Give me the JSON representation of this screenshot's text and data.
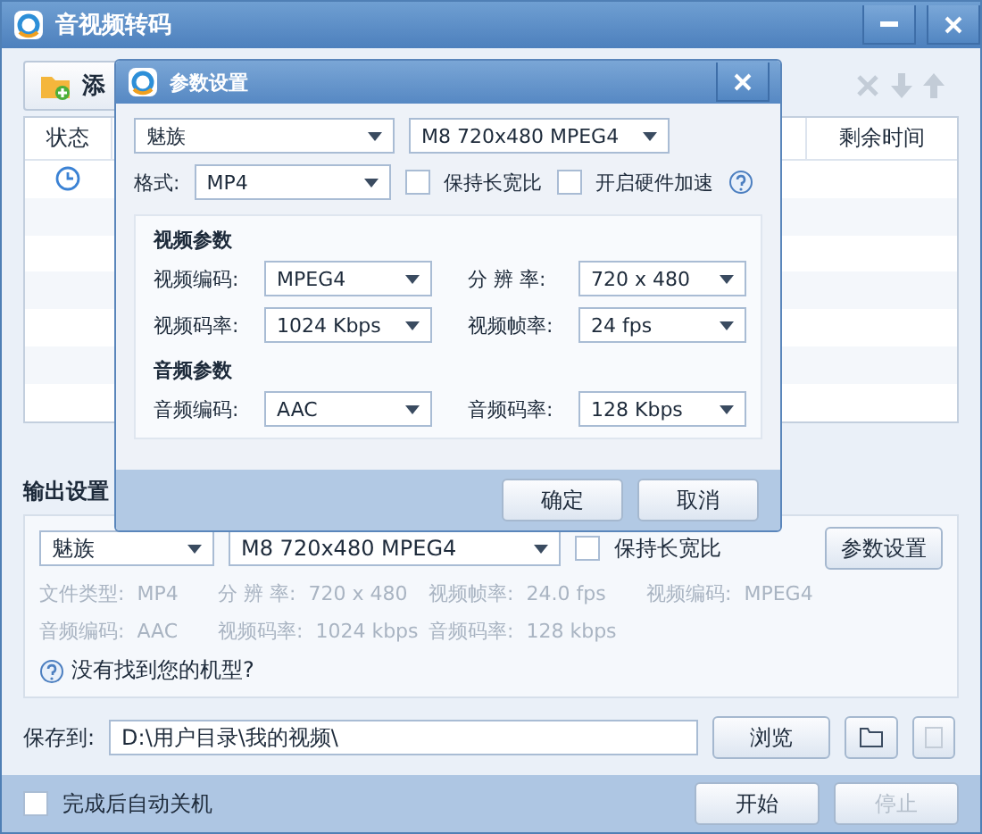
{
  "window": {
    "title": "音视频转码"
  },
  "toolbar": {
    "add_label": "添"
  },
  "table": {
    "columns": [
      "状态",
      "剩余时间"
    ],
    "rows": [
      {
        "kind": "waiting"
      }
    ]
  },
  "output": {
    "title": "输出设置",
    "brand": "魅族",
    "preset": "M8 720x480 MPEG4",
    "keep_ratio": {
      "label": "保持长宽比",
      "checked": false
    },
    "settings_button": "参数设置",
    "info": [
      [
        {
          "label": "文件类型:",
          "value": "MP4"
        },
        {
          "label": "分 辨 率:",
          "value": "720 x 480"
        },
        {
          "label": "视频帧率:",
          "value": "24.0 fps"
        },
        {
          "label": "视频编码:",
          "value": "MPEG4"
        }
      ],
      [
        {
          "label": "音频编码:",
          "value": "AAC"
        },
        {
          "label": "视频码率:",
          "value": "1024 kbps"
        },
        {
          "label": "音频码率:",
          "value": "128 kbps"
        }
      ]
    ],
    "help": "没有找到您的机型?",
    "save_label": "保存到:",
    "save_path": "D:\\用户目录\\我的视频\\",
    "browse": "浏览"
  },
  "footer": {
    "shutdown": {
      "label": "完成后自动关机",
      "checked": false
    },
    "start": {
      "label": "开始",
      "disabled": false
    },
    "stop": {
      "label": "停止",
      "disabled": true
    }
  },
  "dialog": {
    "title": "参数设置",
    "brand": "魅族",
    "preset": "M8 720x480 MPEG4",
    "format_label": "格式:",
    "format": "MP4",
    "checks": [
      {
        "label": "保持长宽比",
        "checked": false
      },
      {
        "label": "开启硬件加速",
        "checked": false
      }
    ],
    "sections": [
      {
        "title": "视频参数",
        "fields": [
          {
            "label": "视频编码:",
            "value": "MPEG4"
          },
          {
            "label": "分 辨 率:",
            "value": "720 x 480"
          },
          {
            "label": "视频码率:",
            "value": "1024 Kbps"
          },
          {
            "label": "视频帧率:",
            "value": "24 fps"
          }
        ]
      },
      {
        "title": "音频参数",
        "fields": [
          {
            "label": "音频编码:",
            "value": "AAC"
          },
          {
            "label": "音频码率:",
            "value": "128 Kbps"
          }
        ]
      }
    ],
    "buttons": [
      "确定",
      "取消"
    ]
  }
}
